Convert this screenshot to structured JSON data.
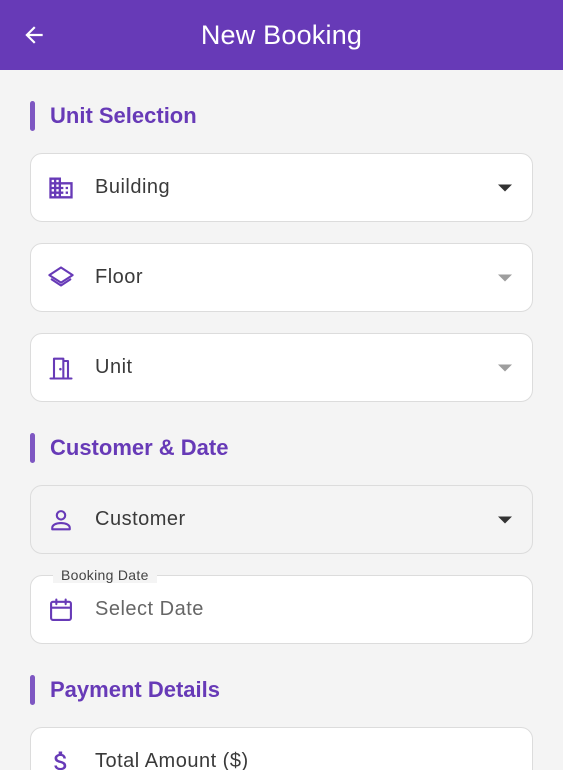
{
  "appbar": {
    "title": "New Booking",
    "back_icon": "arrow-left-icon"
  },
  "sections": {
    "unit_selection": "Unit Selection",
    "customer_date": "Customer & Date",
    "payment_details": "Payment Details"
  },
  "fields": {
    "building": {
      "label": "Building",
      "icon": "building-icon"
    },
    "floor": {
      "label": "Floor",
      "icon": "layers-icon"
    },
    "unit": {
      "label": "Unit",
      "icon": "door-icon"
    },
    "customer": {
      "label": "Customer",
      "icon": "person-icon"
    },
    "booking_date": {
      "label": "Booking Date",
      "placeholder": "Select Date",
      "icon": "calendar-icon"
    },
    "total_amount": {
      "label": "Total Amount ($)",
      "icon": "dollar-icon"
    }
  },
  "colors": {
    "primary": "#673ab7",
    "accent_bar": "#7e57c2",
    "background": "#f4f4f4"
  }
}
